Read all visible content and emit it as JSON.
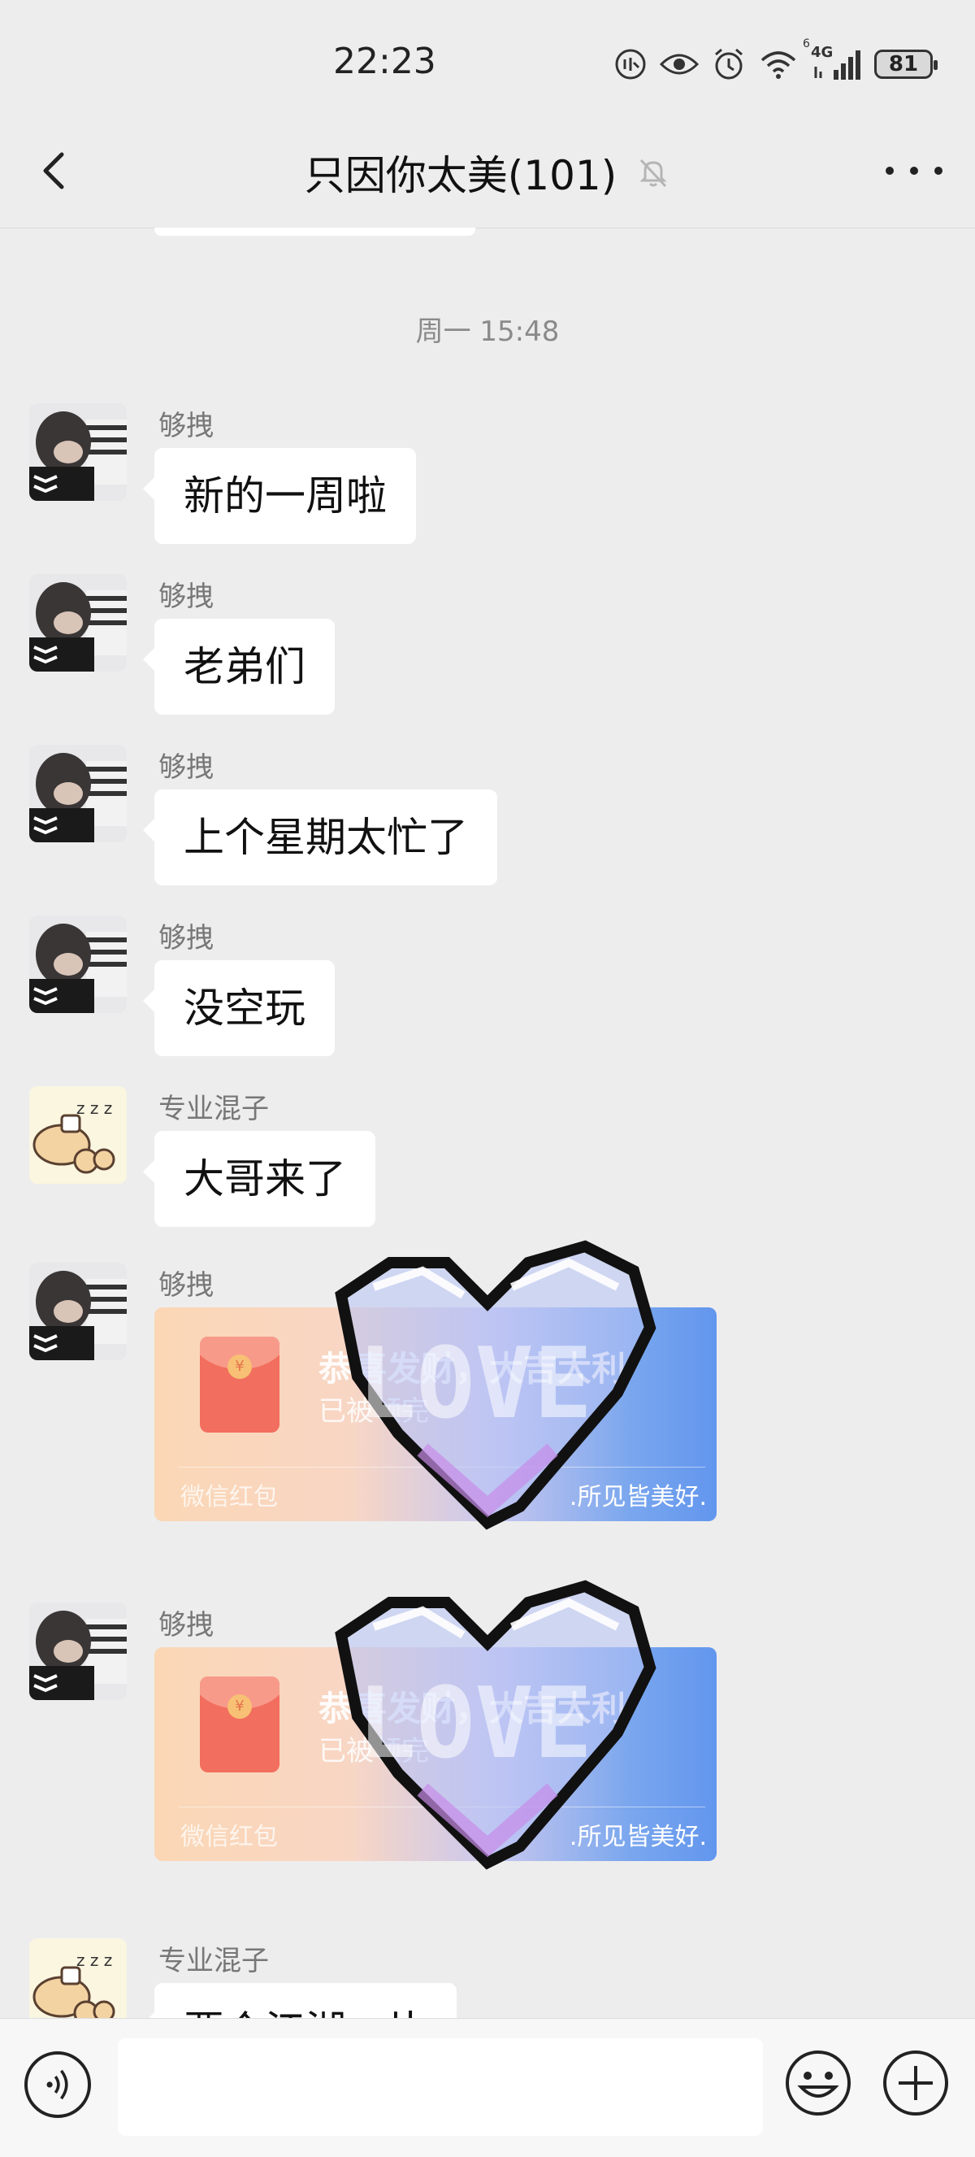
{
  "status_bar": {
    "time": "22:23",
    "network_label": "4G",
    "signal_sup": "6",
    "battery": "81",
    "icons": [
      "hd-call-icon",
      "eye-icon",
      "alarm-icon",
      "wifi-icon",
      "signal-icon",
      "battery-icon"
    ]
  },
  "header": {
    "title": "只因你太美(101)",
    "icons": [
      "back-icon",
      "mute-bell-icon",
      "more-icon"
    ]
  },
  "chat": {
    "timestamp": "周一 15:48",
    "messages": [
      {
        "sender": "够拽",
        "text": "新的一周啦"
      },
      {
        "sender": "够拽",
        "text": "老弟们"
      },
      {
        "sender": "够拽",
        "text": "上个星期太忙了"
      },
      {
        "sender": "够拽",
        "text": "没空玩"
      },
      {
        "sender": "专业混子",
        "text": "大哥来了"
      },
      {
        "sender": "够拽",
        "red_packet": {
          "title": "恭喜发财，大吉大利",
          "status": "已被领完",
          "label": "微信红包",
          "signature": ".所见皆美好."
        }
      },
      {
        "sender": "够拽",
        "red_packet": {
          "title": "恭喜发财，大吉大利",
          "status": "已被领完",
          "label": "微信红包",
          "signature": ".所见皆美好."
        }
      },
      {
        "sender": "专业混子",
        "text": "要个江湖一片"
      }
    ],
    "sticker_text": "LOVE"
  },
  "input_bar": {
    "placeholder": "",
    "icons": [
      "voice-icon",
      "emoji-icon",
      "plus-icon"
    ]
  },
  "colors": {
    "background": "#ededed",
    "bubble": "#ffffff",
    "red_packet_start": "#fbd7b5",
    "red_packet_end": "#6296ee",
    "sender_gray": "#777777"
  }
}
